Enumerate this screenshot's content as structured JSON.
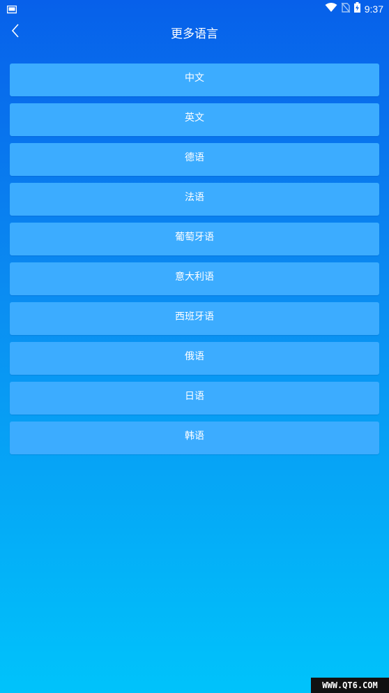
{
  "status_bar": {
    "time": "9:37",
    "icons": [
      "screen-icon",
      "wifi-icon",
      "no-sim-icon",
      "battery-charging-icon"
    ]
  },
  "header": {
    "title": "更多语言",
    "back_icon": "chevron-left-icon"
  },
  "languages": [
    {
      "label": "中文"
    },
    {
      "label": "英文"
    },
    {
      "label": "德语"
    },
    {
      "label": "法语"
    },
    {
      "label": "葡萄牙语"
    },
    {
      "label": "意大利语"
    },
    {
      "label": "西班牙语"
    },
    {
      "label": "俄语"
    },
    {
      "label": "日语"
    },
    {
      "label": "韩语"
    }
  ],
  "colors": {
    "gradient_top": "#0760ea",
    "gradient_bottom": "#00c3fb",
    "item_bg": "#3cacff"
  },
  "watermark": "WWW.QT6.COM"
}
